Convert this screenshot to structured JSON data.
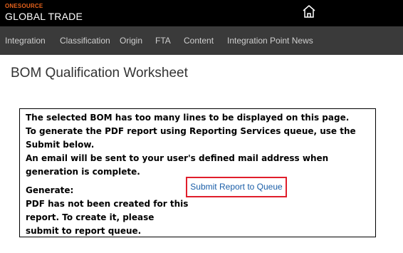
{
  "header": {
    "brand_top": "ONESOURCE",
    "brand_main": "GLOBAL TRADE",
    "home_icon": "home-icon"
  },
  "nav": {
    "items": [
      {
        "label": "Integration"
      },
      {
        "label": "Classification"
      },
      {
        "label": "Origin"
      },
      {
        "label": "FTA"
      },
      {
        "label": "Content"
      },
      {
        "label": "Integration Point News"
      }
    ]
  },
  "page": {
    "title": "BOM Qualification Worksheet"
  },
  "notice": {
    "line1": "The selected BOM has too many lines to be displayed on this page.",
    "line2": "To generate the PDF report using Reporting Services queue, use the Submit below.",
    "line3": "An email will be sent to your user's defined mail address when generation is complete.",
    "generate_label": "Generate:",
    "submit_label": "Submit Report to Queue",
    "pdf_note": "PDF has not been created for this report. To create it, please submit to report queue."
  },
  "colors": {
    "brand_orange": "#e8631c",
    "highlight_red": "#e01e2b",
    "link_blue": "#1a5ea8"
  }
}
